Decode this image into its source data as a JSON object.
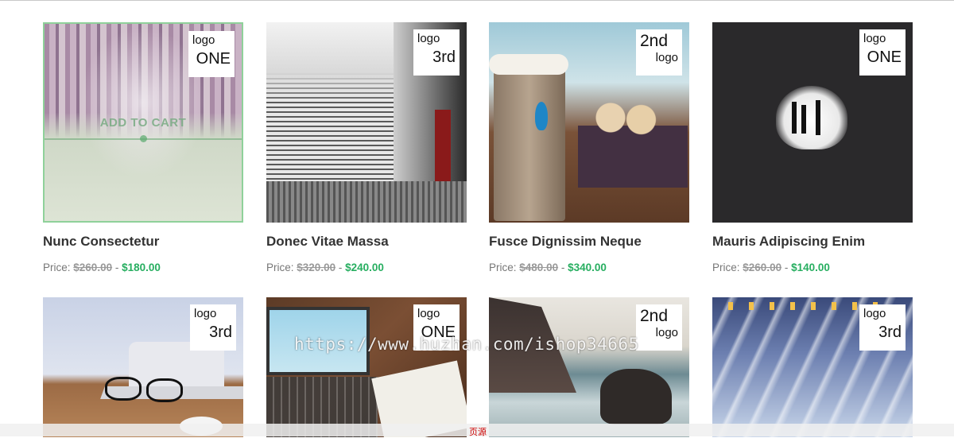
{
  "products": [
    {
      "title": "Nunc Consectetur",
      "price_label": "Price:",
      "old_price": "$260.00",
      "sep": "-",
      "new_price": "$180.00",
      "badge_a": "logo",
      "badge_b": "ONE",
      "add_to_cart": "ADD TO CART"
    },
    {
      "title": "Donec Vitae Massa",
      "price_label": "Price:",
      "old_price": "$320.00",
      "sep": "-",
      "new_price": "$240.00",
      "badge_a": "logo",
      "badge_b": "3rd"
    },
    {
      "title": "Fusce Dignissim Neque",
      "price_label": "Price:",
      "old_price": "$480.00",
      "sep": "-",
      "new_price": "$340.00",
      "badge_a": "2nd",
      "badge_b": "logo"
    },
    {
      "title": "Mauris Adipiscing Enim",
      "price_label": "Price:",
      "old_price": "$260.00",
      "sep": "-",
      "new_price": "$140.00",
      "badge_a": "logo",
      "badge_b": "ONE"
    },
    {
      "badge_a": "logo",
      "badge_b": "3rd"
    },
    {
      "badge_a": "logo",
      "badge_b": "ONE"
    },
    {
      "badge_a": "2nd",
      "badge_b": "logo"
    },
    {
      "badge_a": "logo",
      "badge_b": "3rd"
    }
  ],
  "watermark": "https://www.huzhan.com/ishop34665",
  "bottom_text": "页源"
}
